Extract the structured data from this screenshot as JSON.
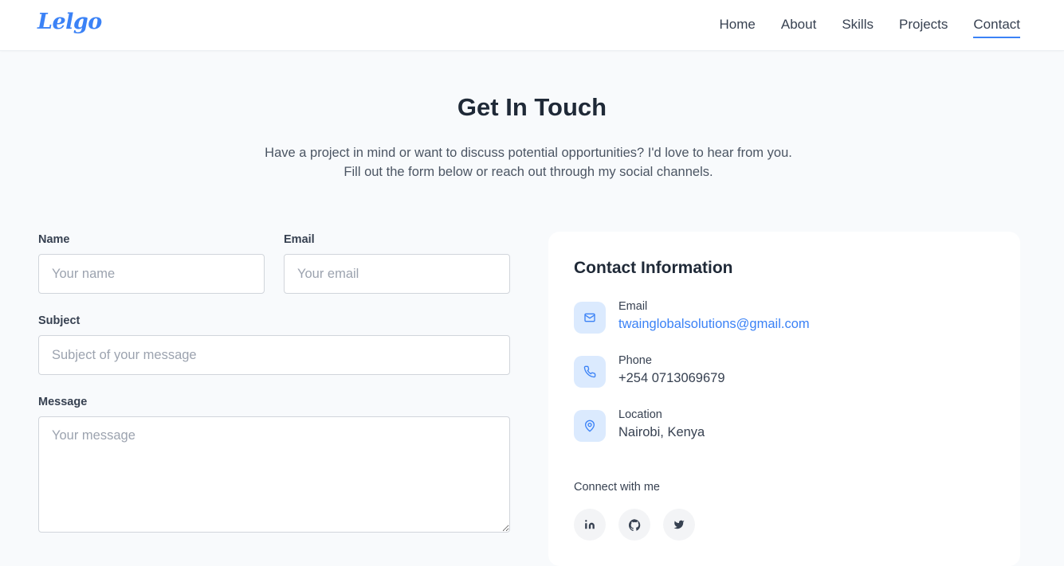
{
  "header": {
    "logo": "Lelgo",
    "nav": [
      "Home",
      "About",
      "Skills",
      "Projects",
      "Contact"
    ],
    "active": "Contact"
  },
  "hero": {
    "title": "Get In Touch",
    "subtitle": "Have a project in mind or want to discuss potential opportunities? I'd love to hear from you. Fill out the form below or reach out through my social channels."
  },
  "form": {
    "name_label": "Name",
    "name_placeholder": "Your name",
    "email_label": "Email",
    "email_placeholder": "Your email",
    "subject_label": "Subject",
    "subject_placeholder": "Subject of your message",
    "message_label": "Message",
    "message_placeholder": "Your message"
  },
  "contact": {
    "title": "Contact Information",
    "email_label": "Email",
    "email_value": "twainglobalsolutions@gmail.com",
    "phone_label": "Phone",
    "phone_value": "+254 0713069679",
    "location_label": "Location",
    "location_value": "Nairobi, Kenya",
    "connect_label": "Connect with me",
    "socials": [
      "linkedin-icon",
      "github-icon",
      "twitter-icon"
    ]
  },
  "colors": {
    "accent": "#3b82f6",
    "background": "#f8fafc",
    "icon_bg": "#dbeafe"
  }
}
